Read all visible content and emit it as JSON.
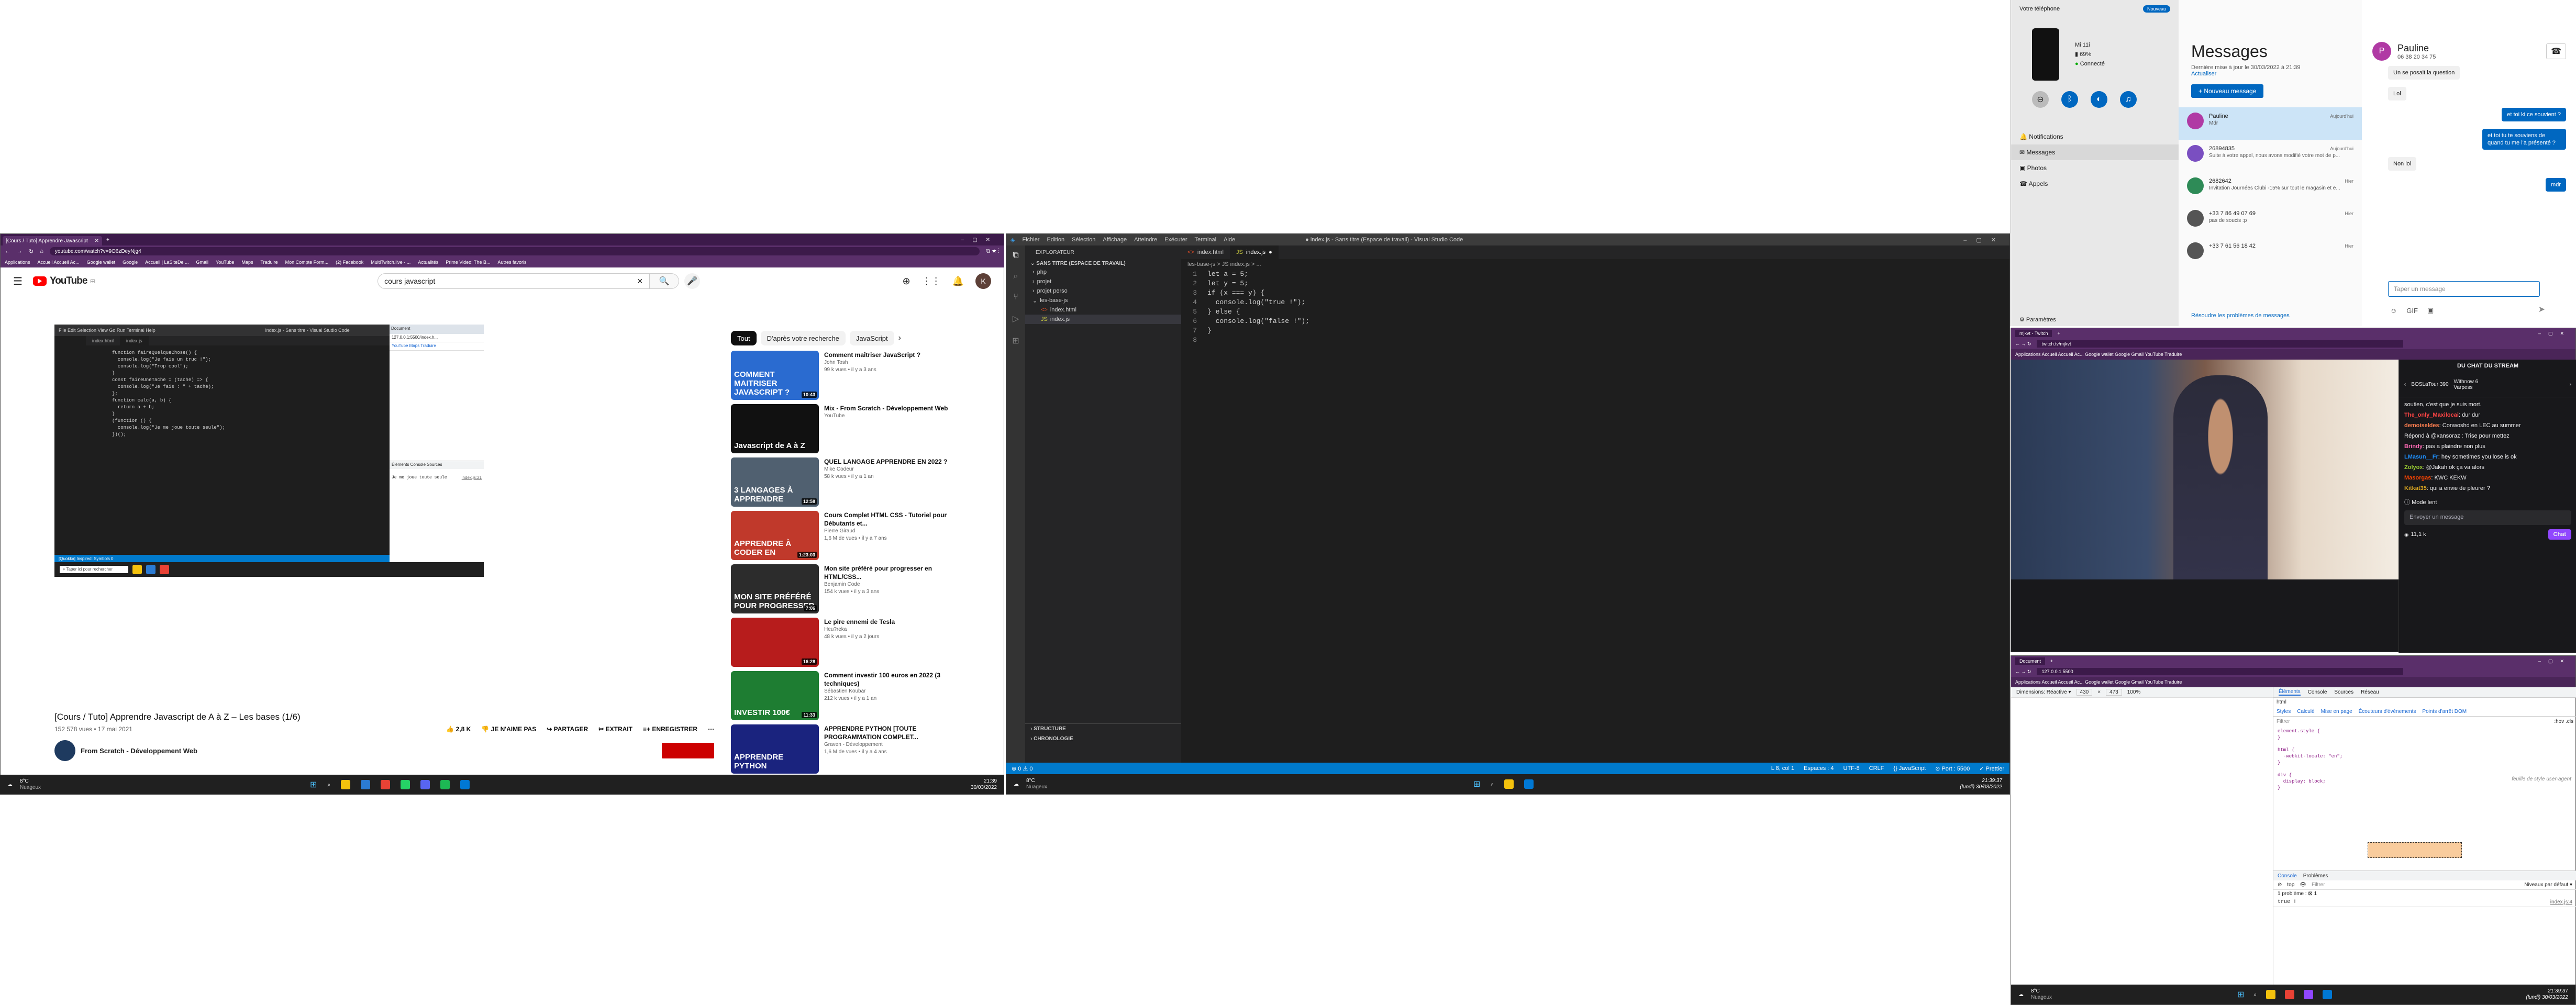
{
  "youtube": {
    "tab_title": "[Cours / Tuto] Apprendre Javascript de A à Z – Les bases (1/6)",
    "url": "youtube.com/watch?v=9O6zDeyNjg4",
    "bookmarks": [
      "Applications",
      "Accueil Accueil Ac...",
      "Google wallet",
      "Google",
      "Accueil | LaSiteDe ...",
      "Gmail",
      "YouTube",
      "Maps",
      "Traduire",
      "Mon Compte Form...",
      "(2) Facebook",
      "MultiTwitch.live - ...",
      "Actualités",
      "Prime Video: The B...",
      "Autres favoris"
    ],
    "logo": "YouTube",
    "logo_sup": "FR",
    "search_value": "cours javascript",
    "video": {
      "editor_tabs": [
        "index.html",
        "index.js"
      ],
      "code": [
        "function faireQuelqueChose() {",
        "  console.log(\"Je fais un truc !\");",
        "  console.log(\"Trop cool\");",
        "}",
        "",
        "const faireUneTache = (tache) => {",
        "  console.log(\"Je fais : \" + tache);",
        "};",
        "",
        "function calc(a, b) {",
        "  return a + b;",
        "}",
        "",
        "(function () {",
        "  console.log(\"Je me joue toute seule\");",
        "})();"
      ],
      "console_output": "Je me joue toute seule",
      "console_src": "index.js:21",
      "status": "[Quokka] Inspired: Symbols  0"
    },
    "title": "[Cours / Tuto] Apprendre Javascript de A à Z – Les bases (1/6)",
    "meta": "152 578 vues • 17 mai 2021",
    "likes": "2,8 K",
    "dislike": "JE N'AIME PAS",
    "share": "PARTAGER",
    "clip": "EXTRAIT",
    "save": "ENREGISTRER",
    "channel": "From Scratch - Développement Web",
    "chips": [
      "Tout",
      "D'après votre recherche",
      "JavaScript"
    ],
    "recs": [
      {
        "thumb": "COMMENT MAITRISER JAVASCRIPT ?",
        "dur": "10:43",
        "color": "#2a6bd0",
        "title": "Comment maîtriser JavaScript ?",
        "ch": "John Tosh",
        "meta": "99 k vues • il y a 3 ans"
      },
      {
        "thumb": "Javascript de A à Z",
        "dur": "",
        "color": "#111111",
        "title": "Mix - From Scratch - Développement Web",
        "ch": "YouTube",
        "meta": ""
      },
      {
        "thumb": "3 LANGAGES À APPRENDRE",
        "dur": "12:58",
        "color": "#506070",
        "title": "QUEL LANGAGE APPRENDRE EN 2022 ?",
        "ch": "Mike Codeur",
        "meta": "58 k vues • il y a 1 an"
      },
      {
        "thumb": "APPRENDRE À CODER EN",
        "dur": "1:23:03",
        "color": "#c0392b",
        "title": "Cours Complet HTML CSS - Tutoriel pour Débutants et...",
        "ch": "Pierre Giraud",
        "meta": "1,6 M de vues • il y a 7 ans"
      },
      {
        "thumb": "MON SITE PRÉFÉRÉ POUR PROGRESSER",
        "dur": "7:06",
        "color": "#2c2c2c",
        "title": "Mon site préféré pour progresser en HTML/CSS...",
        "ch": "Benjamin Code",
        "meta": "154 k vues • il y a 3 ans"
      },
      {
        "thumb": "",
        "dur": "16:28",
        "color": "#b71c1c",
        "title": "Le pire ennemi de Tesla",
        "ch": "Heu?reka",
        "meta": "48 k vues • il y a 2 jours"
      },
      {
        "thumb": "INVESTIR 100€",
        "dur": "11:33",
        "color": "#1e7d32",
        "title": "Comment investir 100 euros en 2022 (3 techniques)",
        "ch": "Sébastien Koubar",
        "meta": "212 k vues • il y a 1 an"
      },
      {
        "thumb": "APPRENDRE PYTHON",
        "dur": "",
        "color": "#1a237e",
        "title": "APPRENDRE PYTHON [TOUTE PROGRAMMATION COMPLET...",
        "ch": "Graven - Développement",
        "meta": "1,6 M de vues • il y a 4 ans"
      }
    ],
    "taskbar": {
      "weather": "8°C",
      "weather_sub": "Nuageux",
      "time": "21:39",
      "date": "30/03/2022",
      "search": "Taper ici pour rechercher"
    }
  },
  "vscode": {
    "window_title": "● index.js - Sans titre (Espace de travail) - Visual Studio Code",
    "menu": [
      "Fichier",
      "Edition",
      "Sélection",
      "Affichage",
      "Atteindre",
      "Exécuter",
      "Terminal",
      "Aide"
    ],
    "explorer_title": "EXPLORATEUR",
    "workspace": "SANS TITRE (ESPACE DE TRAVAIL)",
    "tree": [
      "php",
      "projet",
      "projet perso",
      "les-base-js",
      "index.html",
      "index.js"
    ],
    "tabs": [
      "index.html",
      "index.js"
    ],
    "breadcrumb": "les-base-js > JS index.js > ...",
    "code": [
      "let a = 5;",
      "let y = 5;",
      "if (x === y) {",
      "  console.log(\"true !\");",
      "} else {",
      "  console.log(\"false !\");",
      "}",
      ""
    ],
    "outline": "STRUCTURE",
    "timeline": "CHRONOLOGIE",
    "status_left": "⊗ 0 ⚠ 0",
    "status_right": [
      "L 8, col 1",
      "Espaces : 4",
      "UTF-8",
      "CRLF",
      "{} JavaScript",
      "⊙ Port : 5500",
      "✓ Prettier"
    ],
    "taskbar": {
      "weather": "8°C",
      "weather_sub": "Nuageux",
      "time": "21:39:37",
      "date": "(lundi) 30/03/2022"
    }
  },
  "phone": {
    "app_title": "Votre téléphone",
    "badge": "Nouveau",
    "device": "Mi 11i",
    "battery": "69%",
    "connected": "Connecté",
    "nav": [
      "Notifications",
      "Messages",
      "Photos",
      "Appels"
    ],
    "settings": "Paramètres",
    "heading": "Messages",
    "updated": "Dernière mise à jour le 30/03/2022 à 21:39",
    "refresh": "Actualiser",
    "new_msg": "+ Nouveau message",
    "conversations": [
      {
        "name": "Pauline",
        "preview": "Mdr",
        "time": "Aujourd'hui",
        "color": "#b03aa4"
      },
      {
        "name": "26894835",
        "preview": "Suite à votre appel, nous avons modifié votre mot de p...",
        "time": "Aujourd'hui",
        "color": "#7a4fc1"
      },
      {
        "name": "2682642",
        "preview": "Invitation Journées Clubi -15% sur tout le magasin et e...",
        "time": "Hier",
        "color": "#2e8b57"
      },
      {
        "name": "+33 7 86 49 07 69",
        "preview": "pas de soucis :p",
        "time": "Hier",
        "color": "#555555"
      },
      {
        "name": "+33 7 61 56 18 42",
        "preview": "",
        "time": "Hier",
        "color": "#555555"
      }
    ],
    "troubleshoot": "Résoudre les problèmes de messages",
    "contact": "Pauline",
    "phone_number": "06 38 20 34 75",
    "messages": [
      {
        "text": "Un se posait la question",
        "out": false
      },
      {
        "text": "Lol",
        "out": false
      },
      {
        "text": "et toi ki ce souvient ?",
        "out": true
      },
      {
        "text": "et toi tu te souviens de quand tu me l'a présenté ?",
        "out": true
      },
      {
        "text": "Non lol",
        "out": false
      },
      {
        "text": "mdr",
        "out": true
      }
    ],
    "sender_label": "Pauline",
    "input_placeholder": "Taper un message"
  },
  "twitch": {
    "tab": "mjkvt - Twitch",
    "url": "twitch.tv/mjkvt",
    "chat_title": "DU CHAT DU STREAM",
    "gift1": "BOSLaTour",
    "gift1_n": "390",
    "gift2": "Withnow",
    "gift2_n": "6",
    "gift3": "Varpess",
    "gift3_n": "",
    "chat": [
      {
        "user": "",
        "text": "soutien, c'est que je suis mort.",
        "color": "#efeff1"
      },
      {
        "user": "The_only_Maxilocai",
        "text": "dur dur",
        "color": "#ff4545"
      },
      {
        "user": "demoiseldes",
        "text": "Conwoshd en LEC au summer",
        "color": "#ff7f50"
      },
      {
        "user": "",
        "text": "Répond à @xansoraz : Trise pour mettez",
        "color": "#adadb8"
      },
      {
        "user": "Brindy",
        "text": "pas a plaindre non plus",
        "color": "#ff69b4"
      },
      {
        "user": "LMasun__Fr",
        "text": "hey sometimes you lose is ok",
        "color": "#1e90ff"
      },
      {
        "user": "Zolyox",
        "text": "@Jakah ok ça va alors",
        "color": "#9acd32"
      },
      {
        "user": "Masorgas",
        "text": "KWC KEKW",
        "color": "#ff4500"
      },
      {
        "user": "Kitkat35",
        "text": "qui a envie de pleurer ?",
        "color": "#daa520"
      }
    ],
    "mode": "Mode lent",
    "send_placeholder": "Envoyer un message",
    "chat_btn": "Chat",
    "points": "11,1 k"
  },
  "doc": {
    "tab": "Document",
    "url": "127.0.0.1:5500",
    "devtools_tabs": [
      "Éléments",
      "Console",
      "Sources",
      "Réseau"
    ],
    "dims": "Dimensions: Réactive ▾",
    "w": "430",
    "h": "473",
    "zoom": "100%",
    "style_tabs": [
      "Styles",
      "Calculé",
      "Mise en page",
      "Écouteurs d'événements",
      "Points d'arrêt DOM"
    ],
    "filter": "Filtrer",
    "hov": ":hov .cls",
    "rules": [
      "element.style {",
      "}",
      "",
      "html {",
      "  -webkit-locale: \"en\";",
      "}",
      "",
      "div {",
      "  display: block;",
      "}"
    ],
    "ua": "feuille de style user-agent",
    "console_tabs": [
      "Console",
      "Problèmes"
    ],
    "top": "top",
    "levels": "Niveaux par défaut ▾",
    "issues": "1 problème : ⊠ 1",
    "console_out": "true !",
    "console_src": "index.js:4",
    "taskbar": {
      "weather": "8°C",
      "weather_sub": "Nuageux",
      "time": "21:39:37",
      "date": "(lundi) 30/03/2022"
    }
  }
}
